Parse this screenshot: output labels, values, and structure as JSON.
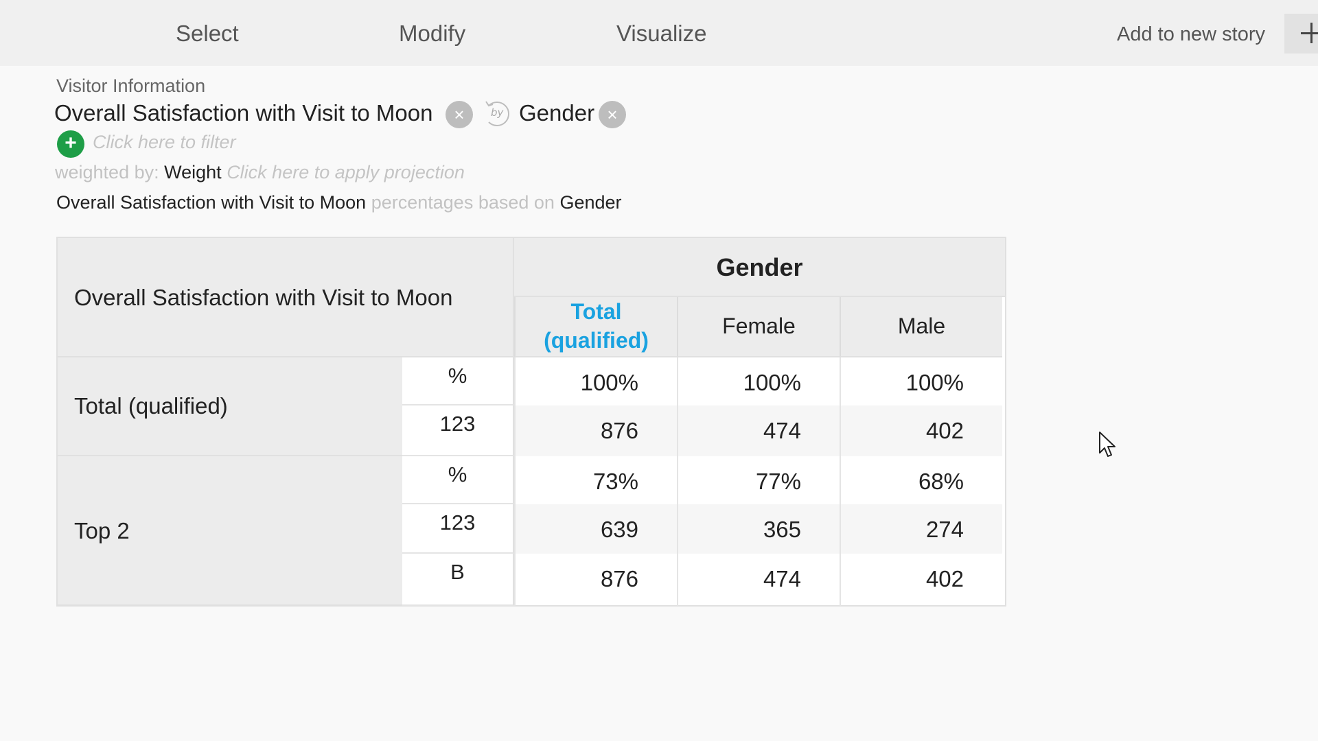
{
  "topbar": {
    "tabs": [
      "Select",
      "Modify",
      "Visualize"
    ],
    "add_story": "Add to new story"
  },
  "query": {
    "dataset": "Visitor Information",
    "variable": "Overall Satisfaction with Visit to Moon",
    "by_label": "by",
    "by_variable": "Gender",
    "filter_hint": "Click here to filter",
    "weight_prefix": "weighted by:",
    "weight_value": "Weight",
    "projection_hint": "Click here to apply projection",
    "summary_var": "Overall Satisfaction with Visit to Moon",
    "summary_mid": "percentages based on",
    "summary_by": "Gender"
  },
  "table": {
    "row_header": "Overall Satisfaction with Visit to Moon",
    "col_group": "Gender",
    "columns": [
      "Total (qualified)",
      "Female",
      "Male"
    ],
    "rows": [
      {
        "label": "Total (qualified)",
        "stats": [
          {
            "stat": "%",
            "values": [
              "100%",
              "100%",
              "100%"
            ]
          },
          {
            "stat": "123",
            "values": [
              "876",
              "474",
              "402"
            ]
          }
        ]
      },
      {
        "label": "Top 2",
        "stats": [
          {
            "stat": "%",
            "values": [
              "73%",
              "77%",
              "68%"
            ]
          },
          {
            "stat": "123",
            "values": [
              "639",
              "365",
              "274"
            ]
          },
          {
            "stat": "B",
            "values": [
              "876",
              "474",
              "402"
            ]
          }
        ]
      }
    ]
  },
  "colors": {
    "accent_blue": "#1aa2e0",
    "add_green": "#1e9e47"
  },
  "icons": {
    "plus": "plus-icon",
    "remove": "close-icon",
    "by": "by-icon",
    "cursor": "mouse-pointer-icon"
  }
}
